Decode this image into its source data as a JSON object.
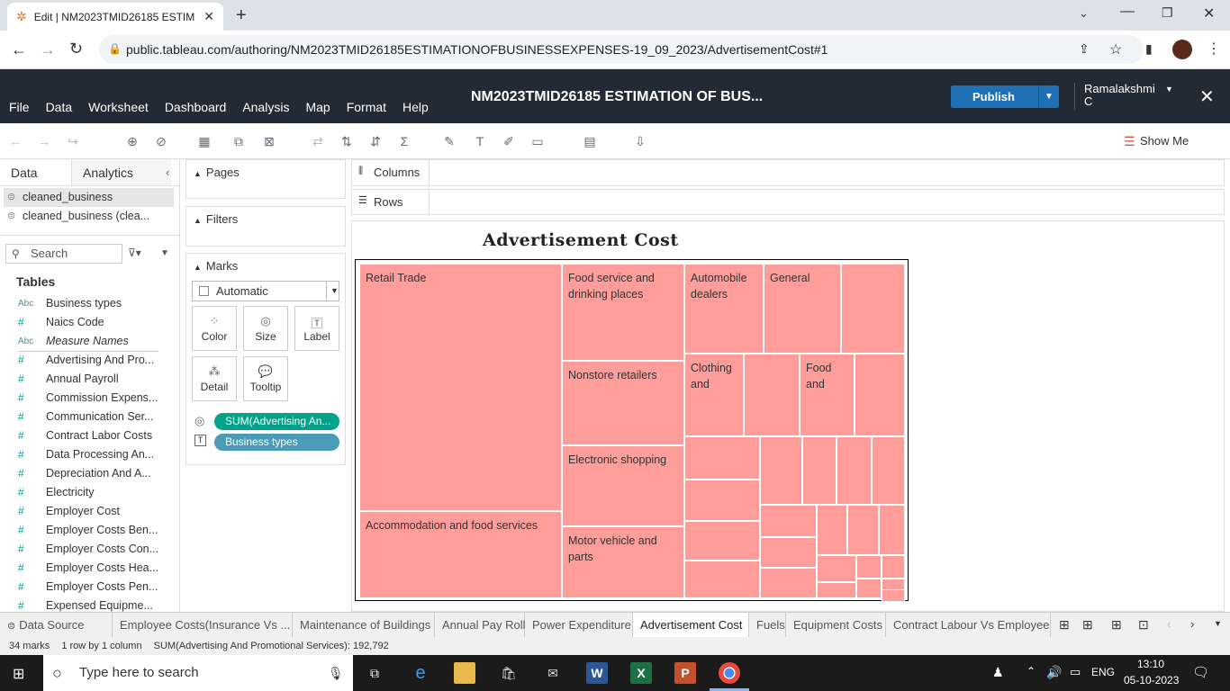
{
  "browser": {
    "tab_title": "Edit | NM2023TMID26185 ESTIM",
    "url": "public.tableau.com/authoring/NM2023TMID26185ESTIMATIONOFBUSINESSEXPENSES-19_09_2023/AdvertisementCost#1"
  },
  "header": {
    "menu": [
      "File",
      "Data",
      "Worksheet",
      "Dashboard",
      "Analysis",
      "Map",
      "Format",
      "Help"
    ],
    "workbook_title": "NM2023TMID26185 ESTIMATION OF BUS...",
    "publish_label": "Publish",
    "user_line1": "Ramalakshmi",
    "user_line2": "C"
  },
  "toolbar": {
    "show_me_label": "Show Me"
  },
  "datapane": {
    "tab_data": "Data",
    "tab_analytics": "Analytics",
    "sources": [
      "cleaned_business",
      "cleaned_business (clea..."
    ],
    "search_placeholder": "Search",
    "tables_heading": "Tables",
    "fields": [
      {
        "type": "Abc",
        "name": "Business types",
        "italic": false
      },
      {
        "type": "#",
        "name": "Naics Code",
        "italic": false
      },
      {
        "type": "Abc",
        "name": "Measure Names",
        "italic": true
      },
      {
        "type": "#",
        "name": "Advertising And Pro...",
        "italic": false
      },
      {
        "type": "#",
        "name": "Annual Payroll",
        "italic": false
      },
      {
        "type": "#",
        "name": "Commission Expens...",
        "italic": false
      },
      {
        "type": "#",
        "name": "Communication Ser...",
        "italic": false
      },
      {
        "type": "#",
        "name": "Contract Labor Costs",
        "italic": false
      },
      {
        "type": "#",
        "name": "Data Processing An...",
        "italic": false
      },
      {
        "type": "#",
        "name": "Depreciation And A...",
        "italic": false
      },
      {
        "type": "#",
        "name": "Electricity",
        "italic": false
      },
      {
        "type": "#",
        "name": "Employer Cost",
        "italic": false
      },
      {
        "type": "#",
        "name": "Employer Costs Ben...",
        "italic": false
      },
      {
        "type": "#",
        "name": "Employer Costs Con...",
        "italic": false
      },
      {
        "type": "#",
        "name": "Employer Costs Hea...",
        "italic": false
      },
      {
        "type": "#",
        "name": "Employer Costs Pen...",
        "italic": false
      },
      {
        "type": "#",
        "name": "Expensed Equipme...",
        "italic": false
      }
    ]
  },
  "shelves": {
    "pages": "Pages",
    "filters": "Filters",
    "marks": "Marks",
    "mark_type": "Automatic",
    "mark_buttons": [
      "Color",
      "Size",
      "Label",
      "Detail",
      "Tooltip"
    ],
    "pill_measure": "SUM(Advertising An...",
    "pill_dimension": "Business types",
    "columns": "Columns",
    "rows": "Rows"
  },
  "view": {
    "title": "Advertisement Cost",
    "mark_color": "#ff9d9a"
  },
  "chart_data": {
    "type": "treemap",
    "title": "Advertisement Cost",
    "measure": "SUM(Advertising And Promotional Services)",
    "total": 192792,
    "labeled_marks": [
      "Retail Trade",
      "Accommodation and food services",
      "Food service and drinking places",
      "Nonstore retailers",
      "Electronic shopping",
      "Motor vehicle and parts",
      "Automobile dealers",
      "General",
      "Clothing and",
      "Food and"
    ],
    "mark_count": 34
  },
  "sheet_tabs": {
    "data_source": "Data Source",
    "sheets": [
      "Employee Costs(Insurance Vs ...",
      "Maintenance of Buildings",
      "Annual Pay Roll",
      "Power Expenditure",
      "Advertisement Cost",
      "Fuels",
      "Equipment Costs",
      "Contract Labour Vs Employee"
    ],
    "active": "Advertisement Cost"
  },
  "status": {
    "marks": "34 marks",
    "dims": "1 row by 1 column",
    "sum": "SUM(Advertising And Promotional Services): 192,792"
  },
  "taskbar": {
    "search_placeholder": "Type here to search",
    "lang": "ENG",
    "time": "13:10",
    "date": "05-10-2023"
  }
}
